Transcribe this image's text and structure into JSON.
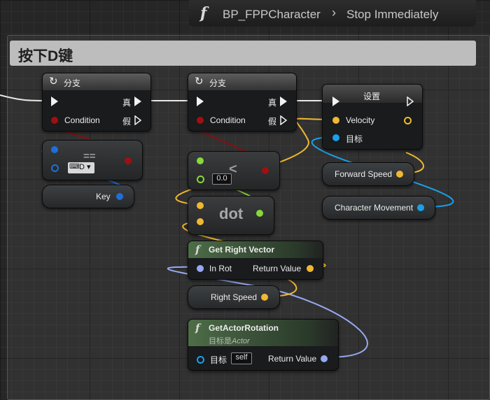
{
  "breadcrumb": {
    "blueprint": "BP_FPPCharacter",
    "separator": "›",
    "function": "Stop Immediately",
    "icon": "function-icon"
  },
  "comment": {
    "title": "按下D键"
  },
  "branch1": {
    "title": "分支",
    "true_label": "真",
    "false_label": "假",
    "condition_label": "Condition"
  },
  "branch2": {
    "title": "分支",
    "true_label": "真",
    "false_label": "假",
    "condition_label": "Condition"
  },
  "set_node": {
    "title": "设置",
    "velocity_label": "Velocity",
    "target_label": "目标"
  },
  "key_equal": {
    "key_value": "D",
    "key_icon": "keyboard-icon",
    "operator": "=="
  },
  "key_getter": {
    "label": "Key"
  },
  "less_node": {
    "operator": "<",
    "value": "0.0"
  },
  "dot_node": {
    "label": "dot"
  },
  "forward_speed": {
    "label": "Forward Speed"
  },
  "character_movement": {
    "label": "Character Movement"
  },
  "get_right_vector": {
    "title": "Get Right Vector",
    "in_label": "In Rot",
    "out_label": "Return Value"
  },
  "right_speed": {
    "label": "Right Speed"
  },
  "get_actor_rotation": {
    "title": "GetActorRotation",
    "subtitle_prefix": "目标是",
    "subtitle_target": "Actor",
    "target_label": "目标",
    "target_value": "self",
    "out_label": "Return Value"
  },
  "colors": {
    "bool": "#a01010",
    "float": "#f0b830",
    "vector": "#f0b830",
    "rotator": "#96a8f0",
    "object": "#1aa0e8",
    "key_struct": "#1e6fd8",
    "func_header": "#4d6d47"
  }
}
